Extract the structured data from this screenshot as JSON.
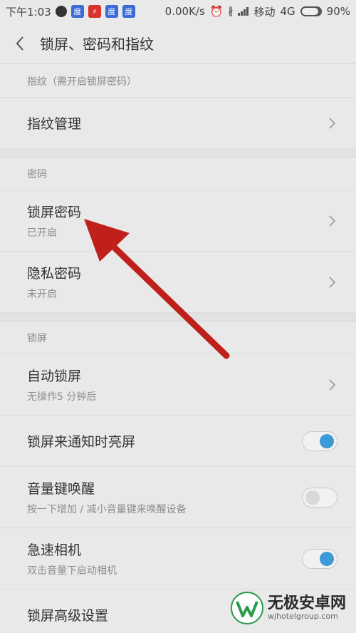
{
  "status": {
    "time": "下午1:03",
    "speed": "0.00K/s",
    "carrier": "移动",
    "network": "4G",
    "battery": "90%",
    "battery_level": 0.9
  },
  "header": {
    "title": "锁屏、密码和指纹"
  },
  "sections": {
    "fingerprint": {
      "header": "指纹（需开启锁屏密码）",
      "manage": "指纹管理"
    },
    "password": {
      "header": "密码",
      "lock_pw": {
        "label": "锁屏密码",
        "sub": "已开启"
      },
      "privacy_pw": {
        "label": "隐私密码",
        "sub": "未开启"
      }
    },
    "lockscreen": {
      "header": "锁屏",
      "auto_lock": {
        "label": "自动锁屏",
        "sub": "无操作5 分钟后"
      },
      "notify_wake": {
        "label": "锁屏来通知时亮屏",
        "on": true
      },
      "volume_wake": {
        "label": "音量键唤醒",
        "sub": "按一下增加 / 减小音量键来唤醒设备",
        "on": false
      },
      "quick_camera": {
        "label": "急速相机",
        "sub": "双击音量下启动相机",
        "on": true
      },
      "advanced": {
        "label": "锁屏高级设置"
      }
    }
  },
  "watermark": {
    "title": "无极安卓网",
    "url": "wjhotelgroup.com"
  },
  "colors": {
    "accent": "#3c9ad6",
    "arrow": "#c0201c"
  }
}
